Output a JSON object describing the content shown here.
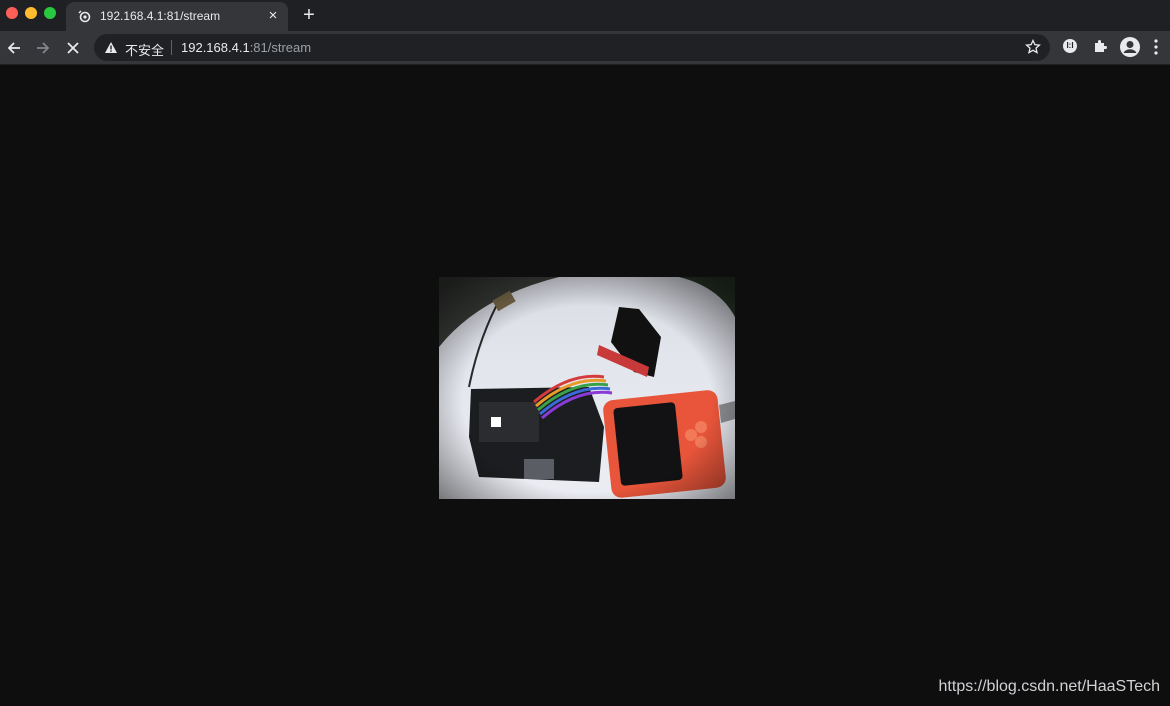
{
  "tab": {
    "title": "192.168.4.1:81/stream",
    "close_glyph": "×"
  },
  "new_tab_glyph": "+",
  "omnibox": {
    "security_label": "不安全",
    "url_host": "192.168.4.1",
    "url_rest": ":81/stream"
  },
  "extension_badge": "I:I",
  "watermark": "https://blog.csdn.net/HaaSTech",
  "icons": {
    "traffic_lights": [
      "close",
      "minimize",
      "maximize"
    ],
    "favicon": "stream-favicon-icon",
    "toolbar": [
      "back-arrow-icon",
      "forward-arrow-icon",
      "stop-loading-icon"
    ],
    "right": [
      "bookmark-star-icon",
      "extension-icon",
      "puzzle-extensions-icon",
      "profile-avatar-icon",
      "kebab-menu-icon"
    ]
  },
  "colors": {
    "chrome_dark": "#1f2023",
    "toolbar": "#35363a",
    "page_bg": "#0e0e0f",
    "board_orange": "#e8553a"
  }
}
